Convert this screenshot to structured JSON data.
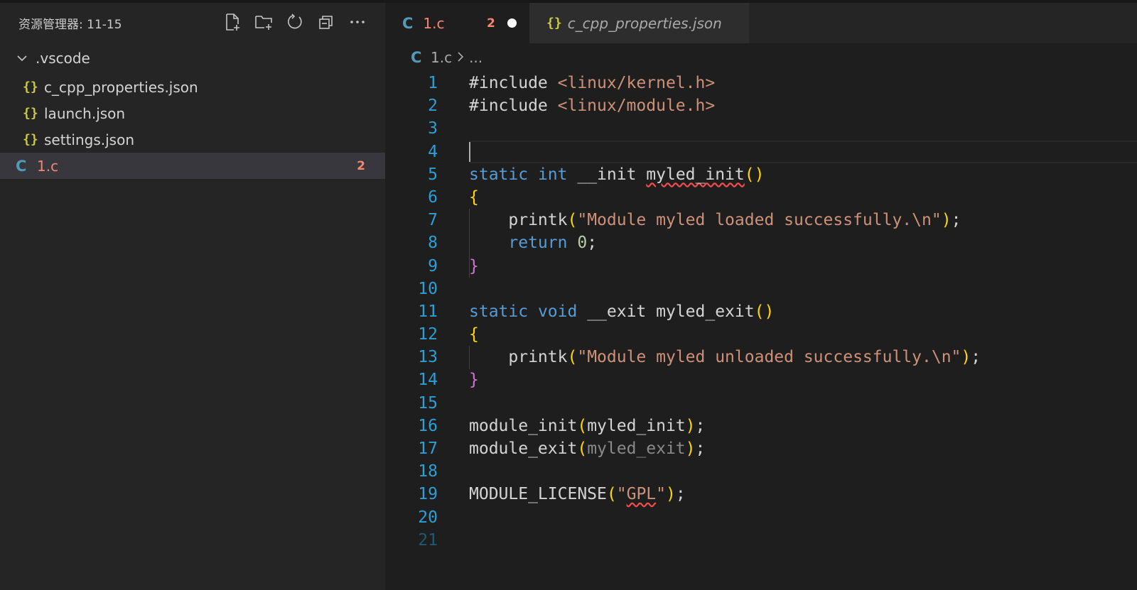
{
  "explorer": {
    "title": "资源管理器: 11-15",
    "actions": [
      "new-file-icon",
      "new-folder-icon",
      "refresh-icon",
      "collapse-all-icon",
      "more-icon"
    ],
    "folder": {
      "name": ".vscode",
      "children": [
        "c_cpp_properties.json",
        "launch.json",
        "settings.json"
      ]
    },
    "file": {
      "name": "1.c",
      "errors": "2"
    }
  },
  "tabs": [
    {
      "label": "1.c",
      "errors": "2",
      "dirty": true
    },
    {
      "label": "c_cpp_properties.json"
    }
  ],
  "breadcrumb": {
    "file": "1.c",
    "sep": ">",
    "rest": "..."
  },
  "code": [
    "#include <linux/kernel.h>",
    "#include <linux/module.h>",
    "",
    "",
    "static int __init myled_init()",
    "{",
    "    printk(\"Module myled loaded successfully.\\n\");",
    "    return 0;",
    "}",
    "",
    "static void __exit myled_exit()",
    "{",
    "    printk(\"Module myled unloaded successfully.\\n\");",
    "}",
    "",
    "module_init(myled_init);",
    "module_exit(myled_exit);",
    "",
    "MODULE_LICENSE(\"GPL\");",
    "",
    ""
  ],
  "line_numbers": [
    "1",
    "2",
    "3",
    "4",
    "5",
    "6",
    "7",
    "8",
    "9",
    "10",
    "11",
    "12",
    "13",
    "14",
    "15",
    "16",
    "17",
    "18",
    "19",
    "20",
    "21"
  ],
  "colors": {
    "keyword": "#569cd6",
    "string": "#ce9178",
    "number": "#b5cea8",
    "error": "#f48771",
    "json_icon": "#cbcb41",
    "c_icon": "#519aba"
  }
}
